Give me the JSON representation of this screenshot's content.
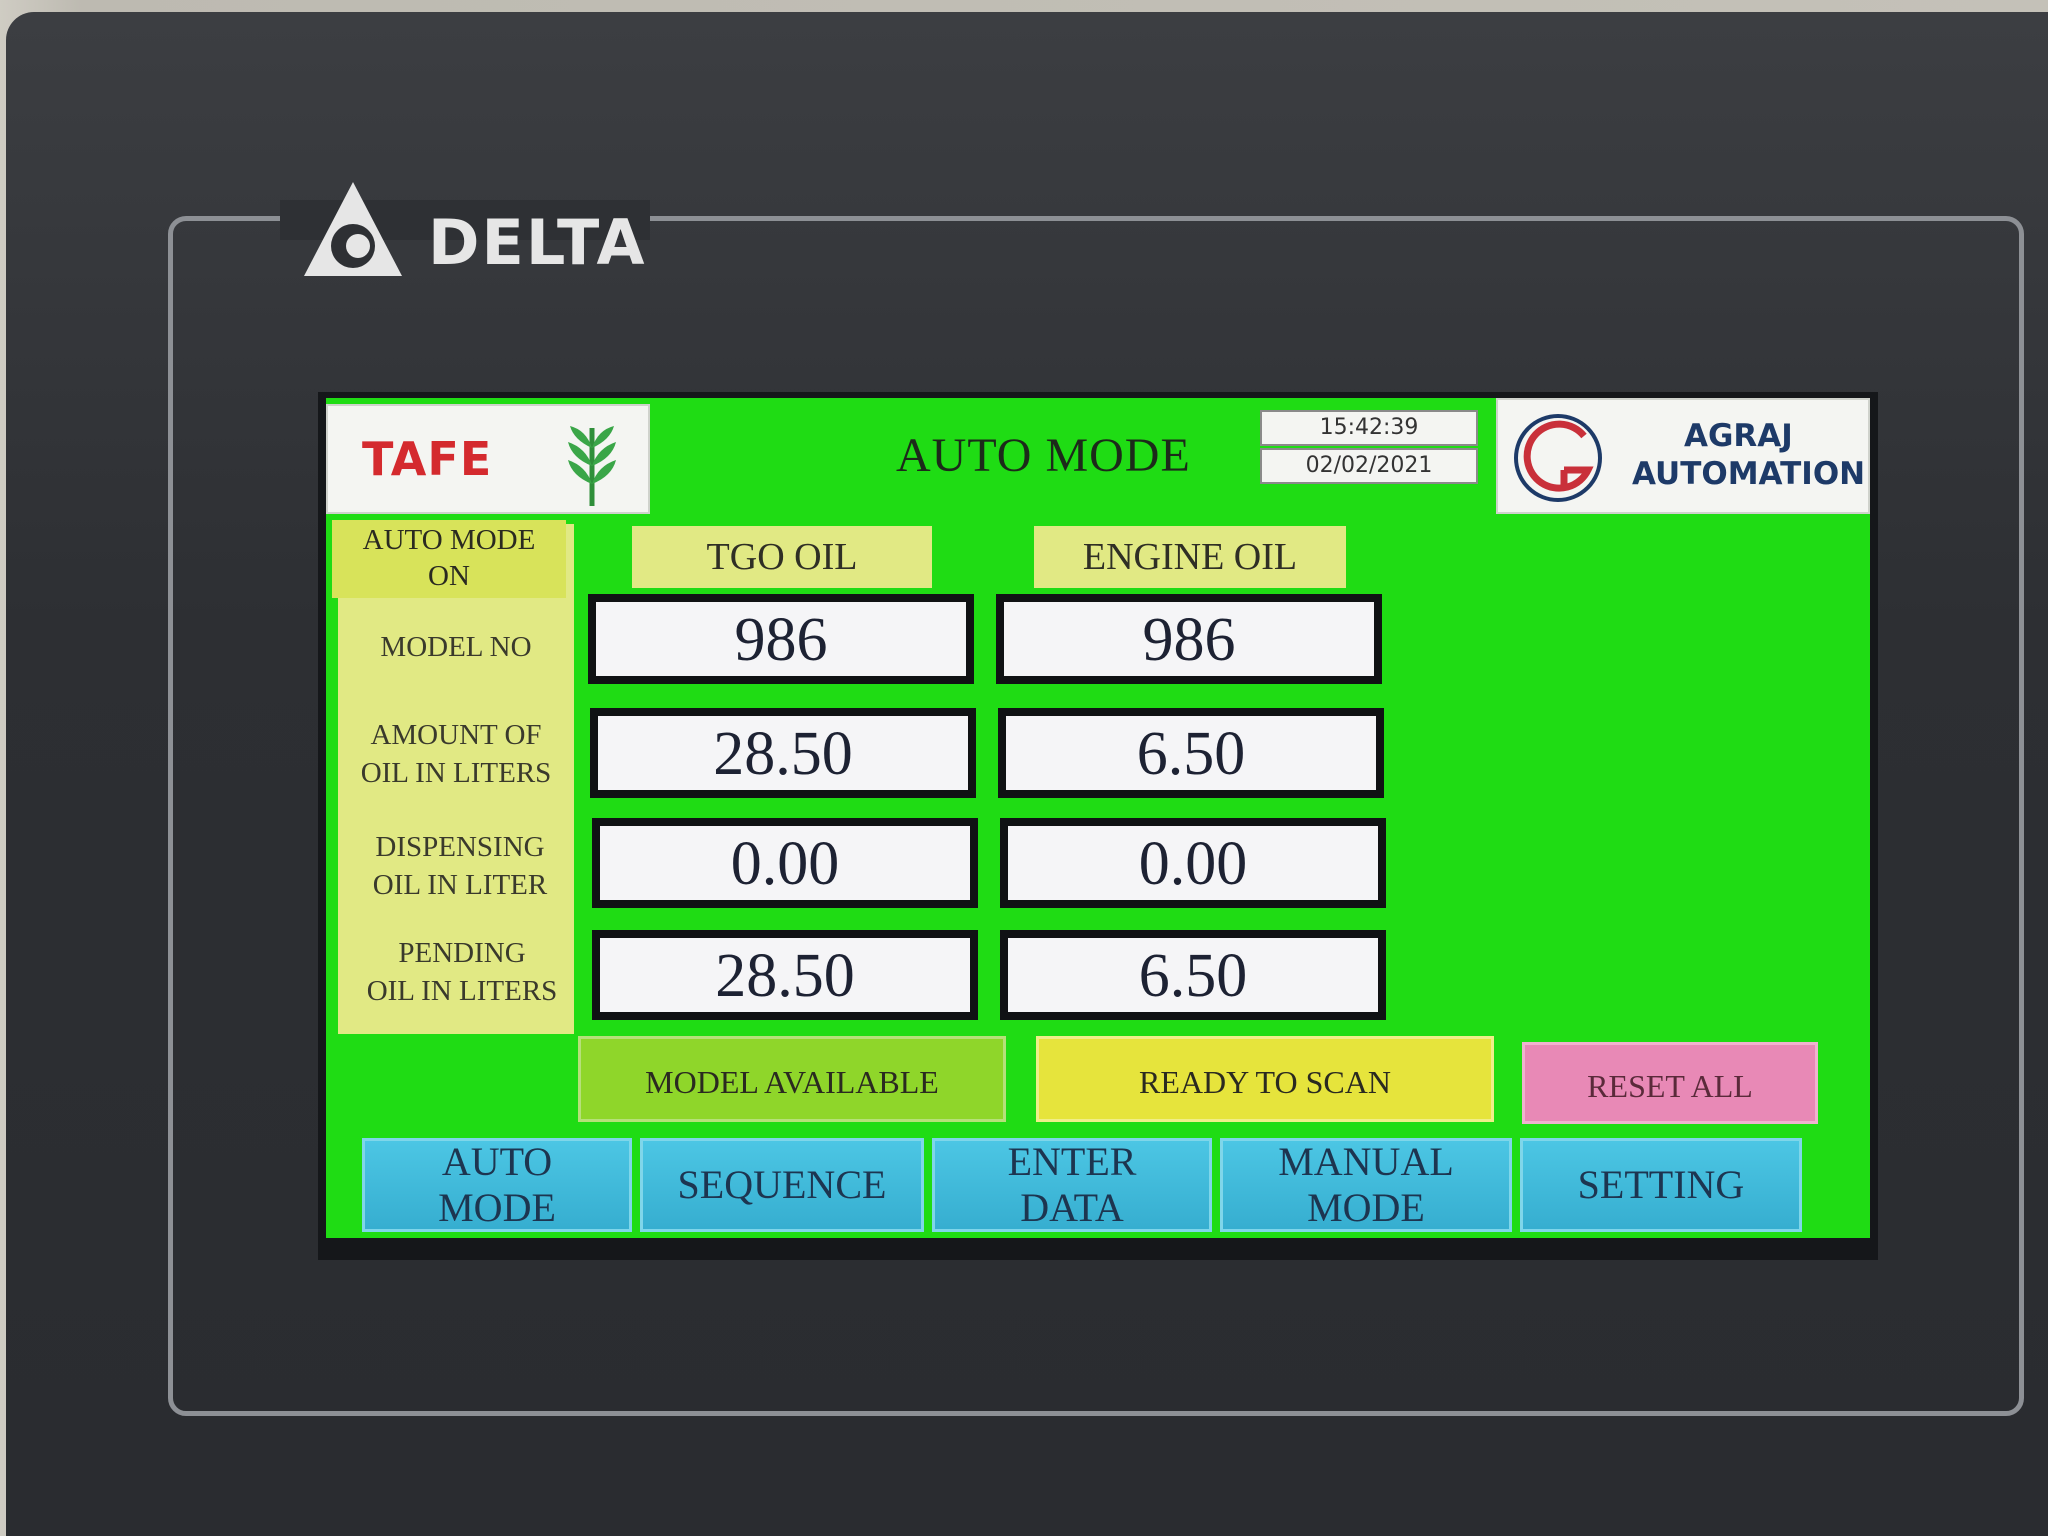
{
  "device": {
    "brand": "DELTA"
  },
  "header": {
    "left_logo": "TAFE",
    "title": "AUTO MODE",
    "time": "15:42:39",
    "date": "02/02/2021",
    "right_logo_line1": "AGRAJ",
    "right_logo_line2": "AUTOMATION"
  },
  "status_label_line1": "AUTO MODE",
  "status_label_line2": "ON",
  "columns": [
    "TGO OIL",
    "ENGINE OIL"
  ],
  "rows": [
    {
      "label_line1": "MODEL NO",
      "label_line2": "",
      "tgo": "986",
      "engine": "986"
    },
    {
      "label_line1": "AMOUNT OF",
      "label_line2": "OIL IN LITERS",
      "tgo": "28.50",
      "engine": "6.50"
    },
    {
      "label_line1": "DISPENSING",
      "label_line2": "OIL IN LITER",
      "tgo": "0.00",
      "engine": "0.00"
    },
    {
      "label_line1": "PENDING",
      "label_line2": "OIL IN LITERS",
      "tgo": "28.50",
      "engine": "6.50"
    }
  ],
  "status_buttons": {
    "model_available": "MODEL AVAILABLE",
    "ready_to_scan": "READY TO SCAN",
    "reset_all": "RESET ALL"
  },
  "nav": [
    {
      "line1": "AUTO",
      "line2": "MODE"
    },
    {
      "line1": "SEQUENCE",
      "line2": ""
    },
    {
      "line1": "ENTER",
      "line2": "DATA"
    },
    {
      "line1": "MANUAL",
      "line2": "MODE"
    },
    {
      "line1": "SETTING",
      "line2": ""
    }
  ],
  "colors": {
    "screen_bg": "#1fdc14",
    "label_bg": "#e1e984",
    "model_available_bg": "#8fd62a",
    "ready_to_scan_bg": "#e6e43c",
    "reset_all_bg": "#e889b6",
    "nav_bg": "#3fb9da",
    "tafe_red": "#d42a2e",
    "agraj_blue": "#1d3a68"
  }
}
